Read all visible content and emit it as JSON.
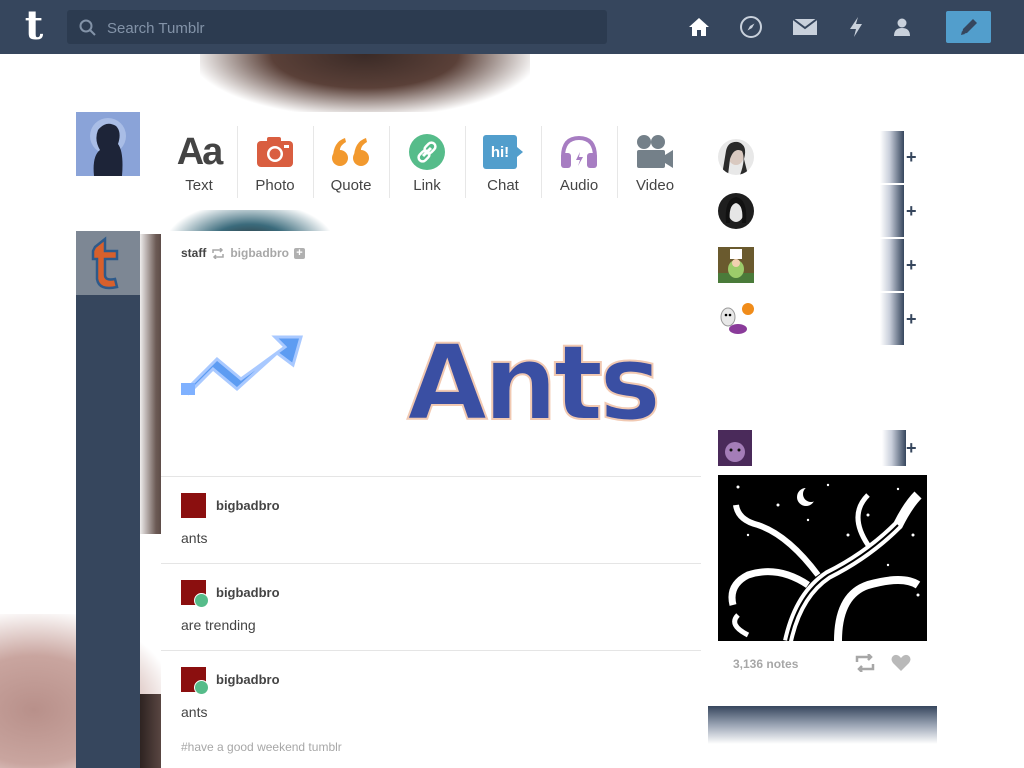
{
  "nav": {
    "search_placeholder": "Search Tumblr"
  },
  "post_types": [
    {
      "label": "Text",
      "icon": "text-icon",
      "color": "#444444"
    },
    {
      "label": "Photo",
      "icon": "camera-icon",
      "color": "#d95e40"
    },
    {
      "label": "Quote",
      "icon": "quote-icon",
      "color": "#f2992e"
    },
    {
      "label": "Link",
      "icon": "link-icon",
      "color": "#56bc8a"
    },
    {
      "label": "Chat",
      "icon": "chat-icon",
      "color": "#529ecc"
    },
    {
      "label": "Audio",
      "icon": "headphones-icon",
      "color": "#a77dc2"
    },
    {
      "label": "Video",
      "icon": "video-camera-icon",
      "color": "#748089"
    }
  ],
  "post": {
    "author": "staff",
    "reblogged_from": "bigbadbro",
    "banner_text": "Ants",
    "entries": [
      {
        "name": "bigbadbro",
        "text": "ants",
        "reblog_badge": false
      },
      {
        "name": "bigbadbro",
        "text": "are trending",
        "reblog_badge": true
      },
      {
        "name": "bigbadbro",
        "text": "ants",
        "reblog_badge": true
      }
    ],
    "tags": "#have a good weekend tumblr"
  },
  "recommended": {
    "follow_label": "+"
  },
  "radar": {
    "notes": "3,136 notes"
  },
  "colors": {
    "nav_bg": "#36465d",
    "accent": "#529ecc"
  }
}
